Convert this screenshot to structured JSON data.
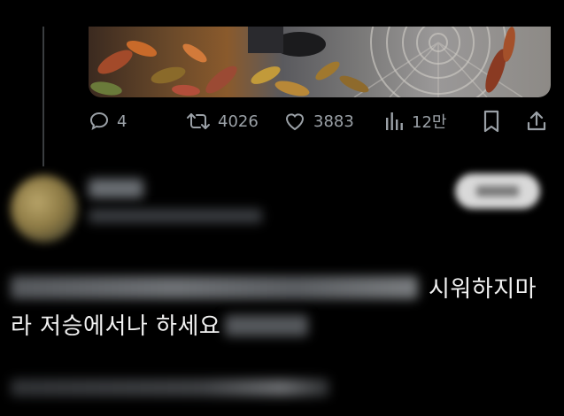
{
  "post": {
    "media": {
      "alt_icon": "photo-plants-on-paved-sidewalk"
    },
    "actions": {
      "reply": {
        "icon": "reply-icon",
        "count": "4"
      },
      "repost": {
        "icon": "repost-icon",
        "count": "4026"
      },
      "like": {
        "icon": "heart-icon",
        "count": "3883"
      },
      "views": {
        "icon": "views-icon",
        "count": "12만"
      },
      "bookmark": {
        "icon": "bookmark-icon"
      },
      "share": {
        "icon": "share-icon"
      }
    }
  },
  "reply": {
    "text_line1_visible": "시워하지마",
    "text_line2_visible": "라 저승에서나 하세요"
  },
  "colors": {
    "background": "#000000",
    "icon_gray": "#9aa0a6",
    "text": "#f1f1f1",
    "thread_line": "#3a3d40"
  }
}
